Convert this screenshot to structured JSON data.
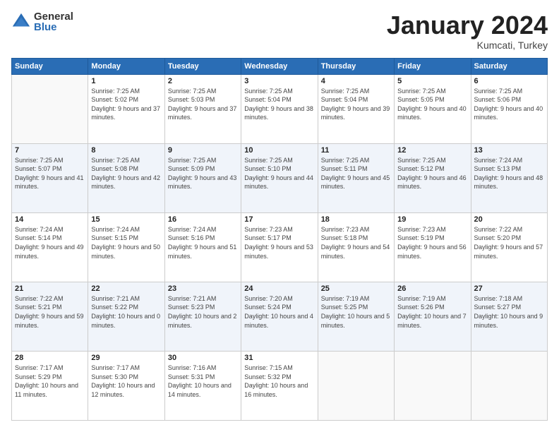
{
  "logo": {
    "general": "General",
    "blue": "Blue"
  },
  "header": {
    "month_year": "January 2024",
    "location": "Kumcati, Turkey"
  },
  "weekdays": [
    "Sunday",
    "Monday",
    "Tuesday",
    "Wednesday",
    "Thursday",
    "Friday",
    "Saturday"
  ],
  "weeks": [
    [
      {
        "day": "",
        "sunrise": "",
        "sunset": "",
        "daylight": ""
      },
      {
        "day": "1",
        "sunrise": "Sunrise: 7:25 AM",
        "sunset": "Sunset: 5:02 PM",
        "daylight": "Daylight: 9 hours and 37 minutes."
      },
      {
        "day": "2",
        "sunrise": "Sunrise: 7:25 AM",
        "sunset": "Sunset: 5:03 PM",
        "daylight": "Daylight: 9 hours and 37 minutes."
      },
      {
        "day": "3",
        "sunrise": "Sunrise: 7:25 AM",
        "sunset": "Sunset: 5:04 PM",
        "daylight": "Daylight: 9 hours and 38 minutes."
      },
      {
        "day": "4",
        "sunrise": "Sunrise: 7:25 AM",
        "sunset": "Sunset: 5:04 PM",
        "daylight": "Daylight: 9 hours and 39 minutes."
      },
      {
        "day": "5",
        "sunrise": "Sunrise: 7:25 AM",
        "sunset": "Sunset: 5:05 PM",
        "daylight": "Daylight: 9 hours and 40 minutes."
      },
      {
        "day": "6",
        "sunrise": "Sunrise: 7:25 AM",
        "sunset": "Sunset: 5:06 PM",
        "daylight": "Daylight: 9 hours and 40 minutes."
      }
    ],
    [
      {
        "day": "7",
        "sunrise": "Sunrise: 7:25 AM",
        "sunset": "Sunset: 5:07 PM",
        "daylight": "Daylight: 9 hours and 41 minutes."
      },
      {
        "day": "8",
        "sunrise": "Sunrise: 7:25 AM",
        "sunset": "Sunset: 5:08 PM",
        "daylight": "Daylight: 9 hours and 42 minutes."
      },
      {
        "day": "9",
        "sunrise": "Sunrise: 7:25 AM",
        "sunset": "Sunset: 5:09 PM",
        "daylight": "Daylight: 9 hours and 43 minutes."
      },
      {
        "day": "10",
        "sunrise": "Sunrise: 7:25 AM",
        "sunset": "Sunset: 5:10 PM",
        "daylight": "Daylight: 9 hours and 44 minutes."
      },
      {
        "day": "11",
        "sunrise": "Sunrise: 7:25 AM",
        "sunset": "Sunset: 5:11 PM",
        "daylight": "Daylight: 9 hours and 45 minutes."
      },
      {
        "day": "12",
        "sunrise": "Sunrise: 7:25 AM",
        "sunset": "Sunset: 5:12 PM",
        "daylight": "Daylight: 9 hours and 46 minutes."
      },
      {
        "day": "13",
        "sunrise": "Sunrise: 7:24 AM",
        "sunset": "Sunset: 5:13 PM",
        "daylight": "Daylight: 9 hours and 48 minutes."
      }
    ],
    [
      {
        "day": "14",
        "sunrise": "Sunrise: 7:24 AM",
        "sunset": "Sunset: 5:14 PM",
        "daylight": "Daylight: 9 hours and 49 minutes."
      },
      {
        "day": "15",
        "sunrise": "Sunrise: 7:24 AM",
        "sunset": "Sunset: 5:15 PM",
        "daylight": "Daylight: 9 hours and 50 minutes."
      },
      {
        "day": "16",
        "sunrise": "Sunrise: 7:24 AM",
        "sunset": "Sunset: 5:16 PM",
        "daylight": "Daylight: 9 hours and 51 minutes."
      },
      {
        "day": "17",
        "sunrise": "Sunrise: 7:23 AM",
        "sunset": "Sunset: 5:17 PM",
        "daylight": "Daylight: 9 hours and 53 minutes."
      },
      {
        "day": "18",
        "sunrise": "Sunrise: 7:23 AM",
        "sunset": "Sunset: 5:18 PM",
        "daylight": "Daylight: 9 hours and 54 minutes."
      },
      {
        "day": "19",
        "sunrise": "Sunrise: 7:23 AM",
        "sunset": "Sunset: 5:19 PM",
        "daylight": "Daylight: 9 hours and 56 minutes."
      },
      {
        "day": "20",
        "sunrise": "Sunrise: 7:22 AM",
        "sunset": "Sunset: 5:20 PM",
        "daylight": "Daylight: 9 hours and 57 minutes."
      }
    ],
    [
      {
        "day": "21",
        "sunrise": "Sunrise: 7:22 AM",
        "sunset": "Sunset: 5:21 PM",
        "daylight": "Daylight: 9 hours and 59 minutes."
      },
      {
        "day": "22",
        "sunrise": "Sunrise: 7:21 AM",
        "sunset": "Sunset: 5:22 PM",
        "daylight": "Daylight: 10 hours and 0 minutes."
      },
      {
        "day": "23",
        "sunrise": "Sunrise: 7:21 AM",
        "sunset": "Sunset: 5:23 PM",
        "daylight": "Daylight: 10 hours and 2 minutes."
      },
      {
        "day": "24",
        "sunrise": "Sunrise: 7:20 AM",
        "sunset": "Sunset: 5:24 PM",
        "daylight": "Daylight: 10 hours and 4 minutes."
      },
      {
        "day": "25",
        "sunrise": "Sunrise: 7:19 AM",
        "sunset": "Sunset: 5:25 PM",
        "daylight": "Daylight: 10 hours and 5 minutes."
      },
      {
        "day": "26",
        "sunrise": "Sunrise: 7:19 AM",
        "sunset": "Sunset: 5:26 PM",
        "daylight": "Daylight: 10 hours and 7 minutes."
      },
      {
        "day": "27",
        "sunrise": "Sunrise: 7:18 AM",
        "sunset": "Sunset: 5:27 PM",
        "daylight": "Daylight: 10 hours and 9 minutes."
      }
    ],
    [
      {
        "day": "28",
        "sunrise": "Sunrise: 7:17 AM",
        "sunset": "Sunset: 5:29 PM",
        "daylight": "Daylight: 10 hours and 11 minutes."
      },
      {
        "day": "29",
        "sunrise": "Sunrise: 7:17 AM",
        "sunset": "Sunset: 5:30 PM",
        "daylight": "Daylight: 10 hours and 12 minutes."
      },
      {
        "day": "30",
        "sunrise": "Sunrise: 7:16 AM",
        "sunset": "Sunset: 5:31 PM",
        "daylight": "Daylight: 10 hours and 14 minutes."
      },
      {
        "day": "31",
        "sunrise": "Sunrise: 7:15 AM",
        "sunset": "Sunset: 5:32 PM",
        "daylight": "Daylight: 10 hours and 16 minutes."
      },
      {
        "day": "",
        "sunrise": "",
        "sunset": "",
        "daylight": ""
      },
      {
        "day": "",
        "sunrise": "",
        "sunset": "",
        "daylight": ""
      },
      {
        "day": "",
        "sunrise": "",
        "sunset": "",
        "daylight": ""
      }
    ]
  ]
}
